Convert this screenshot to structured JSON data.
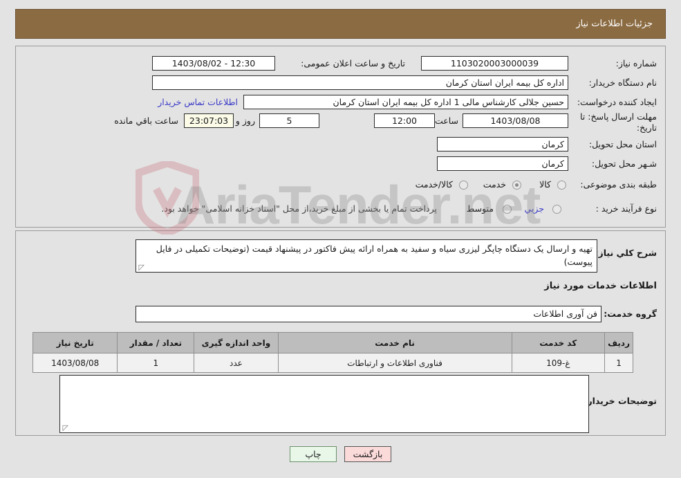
{
  "header": {
    "title": "جزئیات اطلاعات نیاز"
  },
  "form": {
    "need_number": {
      "label": "شماره نیاز:",
      "value": "1103020003000039"
    },
    "announce_datetime": {
      "label": "تاریخ و ساعت اعلان عمومی:",
      "value": "12:30 - 1403/08/02"
    },
    "buyer_org": {
      "label": "نام دستگاه خریدار:",
      "value": "اداره کل بیمه ایران استان کرمان"
    },
    "request_creator": {
      "label": "ایجاد کننده درخواست:",
      "value": "حسین جلالی کارشناس مالی 1 اداره کل بیمه ایران استان کرمان"
    },
    "contact_link": "اطلاعات تماس خریدار",
    "deadline": {
      "label": "مهلت ارسال پاسخ: تا تاریخ:",
      "date": "1403/08/08",
      "time_label": "ساعت",
      "time": "12:00",
      "days": "5",
      "days_label": "روز و",
      "countdown": "23:07:03",
      "countdown_label": "ساعت باقي مانده"
    },
    "delivery_province": {
      "label": "استان محل تحویل:",
      "value": "کرمان"
    },
    "delivery_city": {
      "label": "شـهر محل تحویل:",
      "value": "کرمان"
    },
    "category": {
      "label": "طبقه بندی موضوعی:",
      "options": [
        {
          "label": "کالا",
          "selected": false
        },
        {
          "label": "خدمت",
          "selected": true
        },
        {
          "label": "کالا/خدمت",
          "selected": false
        }
      ]
    },
    "purchase_type": {
      "label": "نوع فرآیند خرید :",
      "options": [
        {
          "label": "جزیي",
          "selected": false
        },
        {
          "label": "متوسط",
          "selected": false
        }
      ],
      "note": "پرداخت تمام یا بخشی از مبلغ خرید،از محل \"اسناد خزانه اسلامی\" خواهد بود."
    }
  },
  "details": {
    "general_desc": {
      "label": "شرح کلي نیاز:",
      "value": "تهیه و ارسال یک دستگاه چاپگر لیزری سیاه و سفید به همراه ارائه پیش فاکتور در پیشنهاد قیمت (توضیحات تکمیلی در فایل پیوست)"
    },
    "section_title": "اطلاعات خدمات مورد نیاز",
    "service_group": {
      "label": "گروه خدمت:",
      "value": "فن آوری اطلاعات"
    },
    "table": {
      "columns": [
        "ردیف",
        "کد خدمت",
        "نام خدمت",
        "واحد اندازه گیری",
        "تعداد / مقدار",
        "تاریخ نیاز"
      ],
      "rows": [
        [
          "1",
          "غ-109",
          "فناوری اطلاعات و ارتباطات",
          "عدد",
          "1",
          "1403/08/08"
        ]
      ]
    },
    "buyer_notes": {
      "label": "توضیحات خریدار:",
      "value": ""
    }
  },
  "buttons": {
    "print": "چاپ",
    "back": "بازگشت"
  },
  "watermark": {
    "text": "AriaTender.net"
  },
  "colors": {
    "header_bg": "#8b6b42",
    "page_bg": "#e3e3e3",
    "link": "#3b3bc8",
    "print_btn": "#e9f7e9",
    "back_btn": "#fbdada",
    "table_header": "#bdbdbd"
  }
}
